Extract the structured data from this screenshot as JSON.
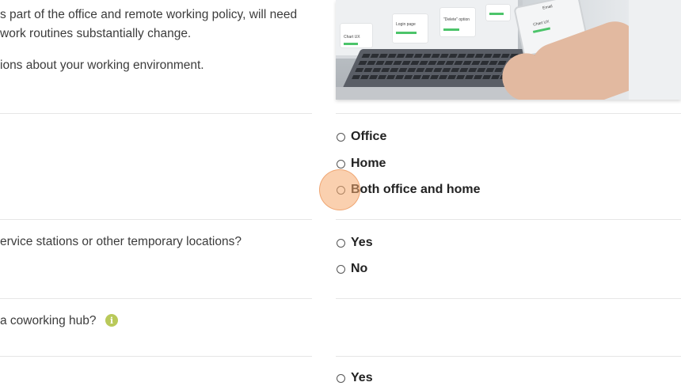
{
  "intro": {
    "line1": "s part of the office and remote working policy, will need",
    "line2": "work routines substantially change.",
    "line3": "ions about your working environment."
  },
  "hero": {
    "card_titles": [
      "Chart UX",
      "Login page",
      "\"Delete\" option",
      "Chart UX",
      "Email"
    ],
    "icon": "laptop-and-phone-photo"
  },
  "q1": {
    "options": [
      "Office",
      "Home",
      "Both office and home"
    ]
  },
  "q2": {
    "text": "ervice stations or other temporary locations?",
    "options": [
      "Yes",
      "No"
    ]
  },
  "q3": {
    "text": "a coworking hub?",
    "info_icon": "info-icon",
    "info_glyph": "i"
  },
  "q4": {
    "options": [
      "Yes"
    ]
  },
  "colors": {
    "accent_info": "#b9c95a",
    "click_marker": "#f5aa6e",
    "divider": "#e6e6e6"
  }
}
